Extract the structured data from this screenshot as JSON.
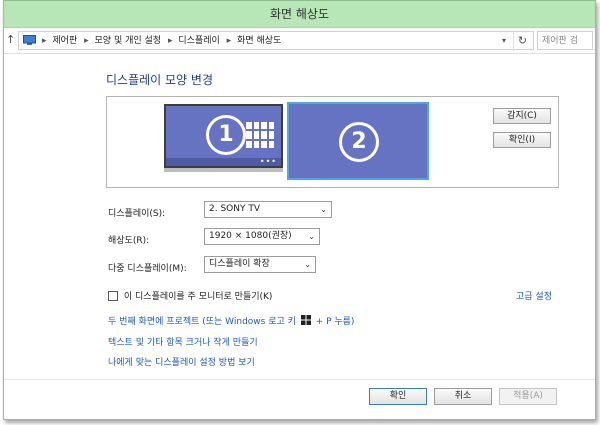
{
  "window": {
    "title": "화면 해상도"
  },
  "address": {
    "crumbs": [
      "제어판",
      "모양 및 개인 설정",
      "디스플레이",
      "화면 해상도"
    ],
    "search_placeholder": "제어판 검"
  },
  "heading": "디스플레이 모양 변경",
  "monitors": {
    "primary_number": "1",
    "secondary_number": "2"
  },
  "side_buttons": {
    "detect": "감지(C)",
    "identify": "확인(I)"
  },
  "form": {
    "display_label": "디스플레이(S):",
    "display_value": "2. SONY TV",
    "resolution_label": "해상도(R):",
    "resolution_value": "1920 × 1080(권장)",
    "multi_label": "다중 디스플레이(M):",
    "multi_value": "디스플레이 확장"
  },
  "checkbox": {
    "label": "이 디스플레이를 주 모니터로 만들기(K)",
    "checked": false
  },
  "links": {
    "advanced": "고급 설정",
    "project_before": "두 번째 화면에 프로젝트 (또는 Windows 로고 키",
    "project_after": "+ P 누름)",
    "text_size": "텍스트 및 기타 항목 크거나 작게 만들기",
    "help": "나에게 맞는 디스플레이 설정 방법 보기"
  },
  "footer": {
    "ok": "확인",
    "cancel": "취소",
    "apply": "적용(A)"
  },
  "colors": {
    "title_bar": "#b7e7b6",
    "monitor_fill": "#6673c2",
    "link": "#1e5bb8",
    "heading": "#1e3f8b"
  }
}
